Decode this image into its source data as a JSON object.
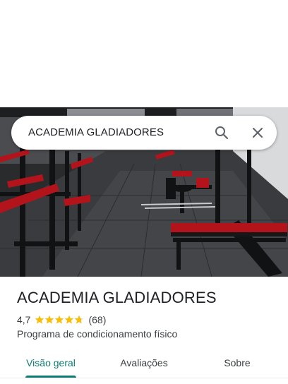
{
  "search": {
    "query": "ACADEMIA GLADIADORES",
    "search_icon": "search-icon",
    "close_icon": "close-icon"
  },
  "hero": {
    "description_icon": "gym-photo"
  },
  "place": {
    "name": "ACADEMIA GLADIADORES",
    "rating": "4,7",
    "rating_value": 4.7,
    "reviews": "(68)",
    "category": "Programa de condicionamento físico"
  },
  "tabs": [
    {
      "label": "Visão geral",
      "selected": true
    },
    {
      "label": "Avaliações",
      "selected": false
    },
    {
      "label": "Sobre",
      "selected": false
    }
  ],
  "colors": {
    "accent": "#0f7b74",
    "star": "#fbbc04",
    "star_empty": "#dadce0"
  }
}
